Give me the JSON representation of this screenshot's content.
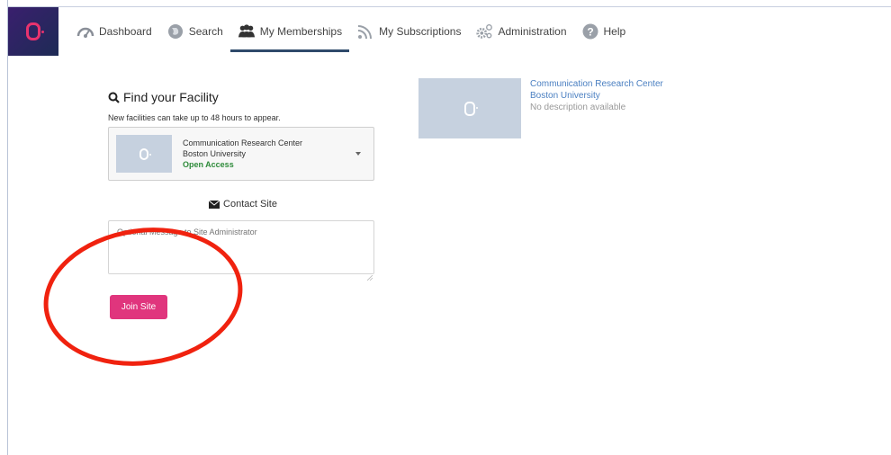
{
  "nav": {
    "items": [
      {
        "label": "Dashboard",
        "icon": "dashboard-gauge-icon"
      },
      {
        "label": "Search",
        "icon": "globe-icon"
      },
      {
        "label": "My Memberships",
        "icon": "group-users-icon",
        "active": true
      },
      {
        "label": "My Subscriptions",
        "icon": "rss-feed-icon"
      },
      {
        "label": "Administration",
        "icon": "gears-icon"
      },
      {
        "label": "Help",
        "icon": "question-circle-icon"
      }
    ]
  },
  "find": {
    "title": "Find your Facility",
    "hint": "New facilities can take up to 48 hours to appear.",
    "selected": {
      "name": "Communication Research Center",
      "institution": "Boston University",
      "access": "Open Access"
    }
  },
  "contact": {
    "label": "Contact Site",
    "message_placeholder": "Optional Message to Site Administrator"
  },
  "join_button": "Join Site",
  "card": {
    "name": "Communication Research Center",
    "institution": "Boston University",
    "description": "No description available"
  },
  "colors": {
    "accent": "#e0357d",
    "nav_active": "#2f4a6b",
    "link": "#4a7fc1",
    "annotation": "#f0220f"
  }
}
